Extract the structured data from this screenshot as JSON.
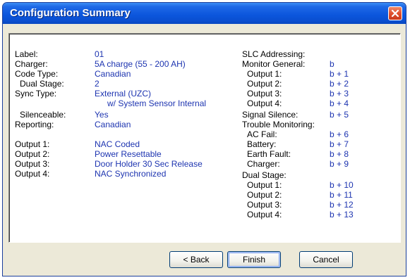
{
  "window": {
    "title": "Configuration Summary"
  },
  "left": [
    {
      "label": "Label:",
      "value": "01"
    },
    {
      "label": "Charger:",
      "value": "5A charge (55 - 200 AH)"
    },
    {
      "label": "Code Type:",
      "value": "Canadian"
    },
    {
      "label": "Dual Stage:",
      "value": "2"
    },
    {
      "label": "Sync Type:",
      "value": "External (UZC)"
    },
    {
      "label": "",
      "value": "w/ System Sensor Internal"
    },
    {
      "label": "Silenceable:",
      "value": "Yes"
    },
    {
      "label": "Reporting:",
      "value": "Canadian"
    },
    {
      "label": "Output 1:",
      "value": "NAC Coded"
    },
    {
      "label": "Output 2:",
      "value": "Power Resettable"
    },
    {
      "label": "Output 3:",
      "value": "Door Holder 30 Sec Release"
    },
    {
      "label": "Output 4:",
      "value": "NAC Synchronized"
    }
  ],
  "right": [
    {
      "label": "SLC Addressing:",
      "value": ""
    },
    {
      "label": "Monitor General:",
      "value": "b"
    },
    {
      "label": "Output 1:",
      "value": "b + 1"
    },
    {
      "label": "Output 2:",
      "value": "b + 2"
    },
    {
      "label": "Output 3:",
      "value": "b + 3"
    },
    {
      "label": "Output 4:",
      "value": "b + 4"
    },
    {
      "label": "Signal Silence:",
      "value": "b + 5"
    },
    {
      "label": "Trouble Monitoring:",
      "value": ""
    },
    {
      "label": "AC Fail:",
      "value": "b + 6"
    },
    {
      "label": "Battery:",
      "value": "b + 7"
    },
    {
      "label": "Earth Fault:",
      "value": "b + 8"
    },
    {
      "label": "Charger:",
      "value": "b + 9"
    },
    {
      "label": "Dual Stage:",
      "value": ""
    },
    {
      "label": "Output 1:",
      "value": "b + 10"
    },
    {
      "label": "Output 2:",
      "value": "b + 11"
    },
    {
      "label": "Output 3:",
      "value": "b + 12"
    },
    {
      "label": "Output 4:",
      "value": "b + 13"
    }
  ],
  "buttons": {
    "back": "< Back",
    "finish": "Finish",
    "cancel": "Cancel"
  },
  "colors": {
    "value_text": "#1d34b0",
    "titlebar": "#0b55dc",
    "dialog_bg": "#ece9d8"
  },
  "icons": {
    "close": "close-icon"
  }
}
